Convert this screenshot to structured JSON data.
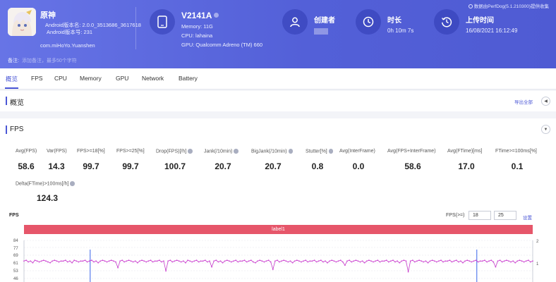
{
  "header": {
    "perfdog_note": "数据由PerfDog(5.1.210300)提供收集",
    "app": {
      "name": "原神",
      "version_line": "Android版本名: 2.0.0_3513686_3617618",
      "code_line": "Android版本号: 231",
      "package": "com.miHoYo.Yuanshen"
    },
    "note_label": "备注:",
    "note_placeholder": "添加备注，最多50个字符",
    "device": {
      "name": "V2141A",
      "memory": "Memory: 11G",
      "cpu": "CPU: lahaina",
      "gpu": "GPU: Qualcomm Adreno (TM) 660"
    },
    "creator_label": "创建者",
    "duration_label": "时长",
    "duration_value": "0h 10m 7s",
    "upload_label": "上传时间",
    "upload_value": "16/08/2021 16:12:49"
  },
  "tabs": [
    "概览",
    "FPS",
    "CPU",
    "Memory",
    "GPU",
    "Network",
    "Battery"
  ],
  "overview": {
    "title": "概览",
    "export_label": "导出全部"
  },
  "fps_section": {
    "title": "FPS",
    "stats_row1": [
      {
        "label": "Avg(FPS)",
        "value": "58.6",
        "help": false
      },
      {
        "label": "Var(FPS)",
        "value": "14.3",
        "help": false
      },
      {
        "label": "FPS>=18[%]",
        "value": "99.7",
        "help": false
      },
      {
        "label": "FPS>=25[%]",
        "value": "99.7",
        "help": false
      },
      {
        "label": "Drop(FPS)[/h]",
        "value": "100.7",
        "help": true
      },
      {
        "label": "Jank(/10min)",
        "value": "20.7",
        "help": true
      },
      {
        "label": "BigJank(/10min)",
        "value": "20.7",
        "help": true
      },
      {
        "label": "Stutter[%]",
        "value": "0.8",
        "help": true
      },
      {
        "label": "Avg(InterFrame)",
        "value": "0.0",
        "help": false
      },
      {
        "label": "Avg(FPS+InterFrame)",
        "value": "58.6",
        "help": false
      },
      {
        "label": "Avg(FTime)[ms]",
        "value": "17.0",
        "help": false
      },
      {
        "label": "FTime>=100ms[%]",
        "value": "0.1",
        "help": false
      }
    ],
    "stats_row2": [
      {
        "label": "Delta(FTime)>100ms[/h]",
        "value": "124.3",
        "help": true
      }
    ],
    "chart_label": "FPS",
    "fps_range_label": "FPS(>=)",
    "fps_range_a": "18",
    "fps_range_b": "25",
    "settings_label": "设置",
    "label_bar": "label1"
  },
  "chart_data": {
    "type": "line",
    "title": "FPS",
    "ylabel": "",
    "ylim": [
      38,
      84
    ],
    "y_ticks": [
      "84",
      "77",
      "69",
      "61",
      "53",
      "46"
    ],
    "right_ticks": [
      "2",
      "1"
    ],
    "series": [
      {
        "values": [
          59,
          60,
          58,
          59,
          57,
          60,
          59,
          58,
          59,
          60,
          59,
          58,
          57,
          59,
          60,
          59,
          58,
          59,
          59,
          60,
          58,
          59,
          57,
          60,
          59,
          58,
          59,
          59,
          60,
          58,
          59,
          60,
          58,
          59,
          57,
          59,
          60,
          59,
          58,
          59,
          60,
          59,
          58,
          51,
          59,
          60,
          58,
          59,
          60,
          59,
          58,
          59,
          57,
          59,
          60,
          59,
          58,
          59,
          60,
          58,
          59,
          59,
          60,
          58,
          59,
          47,
          59,
          60,
          58,
          59,
          60,
          59,
          58,
          59,
          57,
          60,
          59,
          58,
          59,
          60,
          58,
          59,
          59,
          60,
          58,
          59,
          52,
          59,
          60,
          58,
          59,
          57,
          59,
          60,
          59,
          58,
          59,
          60,
          58,
          59,
          59,
          60,
          58,
          59,
          60,
          58,
          57,
          59,
          60,
          59,
          58,
          59,
          60,
          58,
          49,
          59,
          60,
          58,
          59,
          60,
          59,
          58,
          59,
          57,
          59,
          60,
          59,
          58,
          59,
          60,
          58,
          59,
          59,
          60,
          58,
          59,
          60,
          58,
          59,
          57,
          59,
          60,
          59,
          58,
          59,
          60,
          58,
          54,
          59,
          60,
          58,
          59,
          60,
          59,
          58,
          59,
          57,
          59,
          60,
          59,
          58,
          59,
          60,
          58,
          59,
          59,
          60,
          58,
          59,
          60,
          58,
          59,
          57,
          59,
          60,
          59,
          46,
          59,
          60,
          58,
          59,
          60,
          59,
          58,
          59,
          57,
          59,
          60,
          59,
          58,
          59,
          60,
          58,
          59,
          59,
          60,
          58,
          59,
          60,
          58,
          59,
          57,
          59,
          60,
          59,
          58,
          59,
          60,
          58,
          59,
          59,
          60,
          58,
          59,
          60,
          58,
          52,
          59,
          60,
          58,
          59,
          60,
          59,
          58,
          59,
          57,
          59,
          60,
          59,
          58,
          59,
          60,
          58,
          59
        ]
      }
    ],
    "markers": [
      0.13,
      0.89
    ]
  }
}
